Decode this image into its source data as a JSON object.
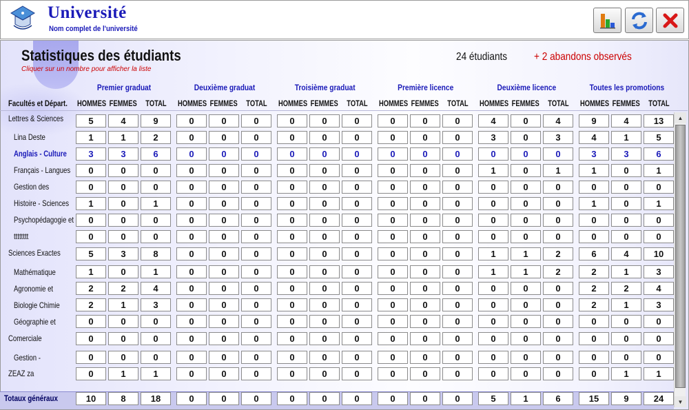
{
  "header": {
    "title": "Université",
    "subtitle": "Nom complet de l'université"
  },
  "stats": {
    "title": "Statistiques des étudiants",
    "hint": "Cliquer sur un nombre pour afficher la liste",
    "student_count": "24 étudiants",
    "dropouts": "+ 2 abandons observés"
  },
  "table": {
    "row_header": "Facultés et Départ.",
    "groups": [
      "Premier graduat",
      "Deuxième graduat",
      "Troisième graduat",
      "Première licence",
      "Deuxième licence",
      "Toutes les promotions"
    ],
    "subcolumns": [
      "HOMMES",
      "FEMMES",
      "TOTAL"
    ],
    "rows": [
      {
        "label": "Lettres & Sciences",
        "kind": "faculty",
        "values": [
          5,
          4,
          9,
          0,
          0,
          0,
          0,
          0,
          0,
          0,
          0,
          0,
          4,
          0,
          4,
          9,
          4,
          13
        ]
      },
      {
        "label": "Lina Deste",
        "kind": "dept",
        "values": [
          1,
          1,
          2,
          0,
          0,
          0,
          0,
          0,
          0,
          0,
          0,
          0,
          3,
          0,
          3,
          4,
          1,
          5
        ]
      },
      {
        "label": "Anglais - Culture",
        "kind": "dept-hl",
        "values": [
          3,
          3,
          6,
          0,
          0,
          0,
          0,
          0,
          0,
          0,
          0,
          0,
          0,
          0,
          0,
          3,
          3,
          6
        ]
      },
      {
        "label": "Français - Langues",
        "kind": "dept",
        "values": [
          0,
          0,
          0,
          0,
          0,
          0,
          0,
          0,
          0,
          0,
          0,
          0,
          1,
          0,
          1,
          1,
          0,
          1
        ]
      },
      {
        "label": "Gestion des",
        "kind": "dept",
        "values": [
          0,
          0,
          0,
          0,
          0,
          0,
          0,
          0,
          0,
          0,
          0,
          0,
          0,
          0,
          0,
          0,
          0,
          0
        ]
      },
      {
        "label": "Histoire - Sciences",
        "kind": "dept",
        "values": [
          1,
          0,
          1,
          0,
          0,
          0,
          0,
          0,
          0,
          0,
          0,
          0,
          0,
          0,
          0,
          1,
          0,
          1
        ]
      },
      {
        "label": "Psychopédagogie et",
        "kind": "dept",
        "values": [
          0,
          0,
          0,
          0,
          0,
          0,
          0,
          0,
          0,
          0,
          0,
          0,
          0,
          0,
          0,
          0,
          0,
          0
        ]
      },
      {
        "label": "tttttttt",
        "kind": "dept",
        "values": [
          0,
          0,
          0,
          0,
          0,
          0,
          0,
          0,
          0,
          0,
          0,
          0,
          0,
          0,
          0,
          0,
          0,
          0
        ]
      },
      {
        "label": "Sciences Exactes",
        "kind": "faculty",
        "values": [
          5,
          3,
          8,
          0,
          0,
          0,
          0,
          0,
          0,
          0,
          0,
          0,
          1,
          1,
          2,
          6,
          4,
          10
        ]
      },
      {
        "label": "Mathématique",
        "kind": "dept",
        "values": [
          1,
          0,
          1,
          0,
          0,
          0,
          0,
          0,
          0,
          0,
          0,
          0,
          1,
          1,
          2,
          2,
          1,
          3
        ]
      },
      {
        "label": "Agronomie et",
        "kind": "dept",
        "values": [
          2,
          2,
          4,
          0,
          0,
          0,
          0,
          0,
          0,
          0,
          0,
          0,
          0,
          0,
          0,
          2,
          2,
          4
        ]
      },
      {
        "label": "Biologie Chimie",
        "kind": "dept",
        "values": [
          2,
          1,
          3,
          0,
          0,
          0,
          0,
          0,
          0,
          0,
          0,
          0,
          0,
          0,
          0,
          2,
          1,
          3
        ]
      },
      {
        "label": "Géographie et",
        "kind": "dept",
        "values": [
          0,
          0,
          0,
          0,
          0,
          0,
          0,
          0,
          0,
          0,
          0,
          0,
          0,
          0,
          0,
          0,
          0,
          0
        ]
      },
      {
        "label": "Comerciale",
        "kind": "faculty",
        "values": [
          0,
          0,
          0,
          0,
          0,
          0,
          0,
          0,
          0,
          0,
          0,
          0,
          0,
          0,
          0,
          0,
          0,
          0
        ]
      },
      {
        "label": "Gestion -",
        "kind": "dept",
        "values": [
          0,
          0,
          0,
          0,
          0,
          0,
          0,
          0,
          0,
          0,
          0,
          0,
          0,
          0,
          0,
          0,
          0,
          0
        ]
      },
      {
        "label": "ZEAZ za",
        "kind": "faculty",
        "values": [
          0,
          1,
          1,
          0,
          0,
          0,
          0,
          0,
          0,
          0,
          0,
          0,
          0,
          0,
          0,
          0,
          1,
          1
        ]
      }
    ],
    "totals": {
      "label": "Totaux généraux",
      "values": [
        10,
        8,
        18,
        0,
        0,
        0,
        0,
        0,
        0,
        0,
        0,
        0,
        5,
        1,
        6,
        15,
        9,
        24
      ]
    }
  },
  "colors": {
    "accent_blue": "#1a1ab8",
    "alert_red": "#cc0000",
    "total_bar": "#c9c9ee"
  },
  "icons": {
    "chart": "bar-chart-icon",
    "refresh": "refresh-icon",
    "close": "close-icon"
  }
}
